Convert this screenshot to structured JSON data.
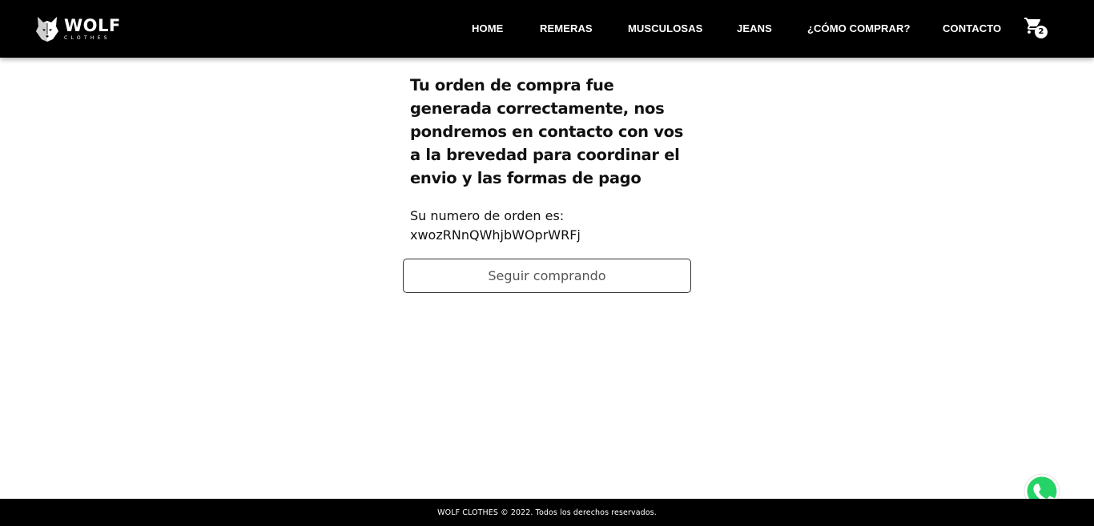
{
  "brand": {
    "name": "WOLF",
    "tagline": "CLOTHES"
  },
  "nav": {
    "items": [
      {
        "label": "HOME"
      },
      {
        "label": "REMERAS"
      },
      {
        "label": "MUSCULOSAS"
      },
      {
        "label": "JEANS"
      },
      {
        "label": "¿CÓMO COMPRAR?"
      },
      {
        "label": "CONTACTO"
      }
    ],
    "cart": {
      "icon": "cart-icon",
      "count": "2"
    }
  },
  "main": {
    "title": "Tu orden de compra fue generada correctamente, nos pondremos en contacto con vos a la brevedad para coordinar el envio y las formas de pago",
    "order_label": "Su numero de orden es:",
    "order_number": "xwozRNnQWhjbWOprWRFj",
    "continue_label": "Seguir comprando"
  },
  "footer": {
    "text": "WOLF CLOTHES © 2022. Todos los derechos reservados."
  },
  "colors": {
    "header_bg": "#000000",
    "whatsapp": "#25D366",
    "page_bg": "#ffffff"
  },
  "icons": {
    "whatsapp": "whatsapp-icon",
    "logo": "wolf-logo-icon"
  }
}
